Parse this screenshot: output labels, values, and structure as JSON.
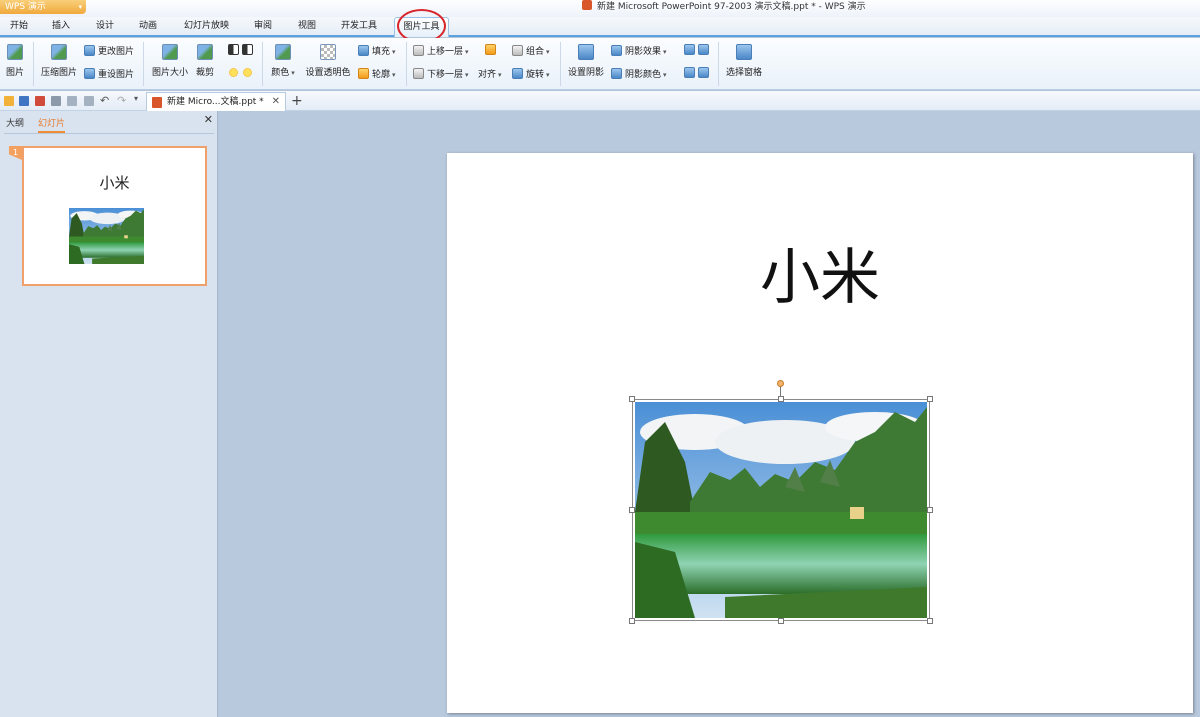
{
  "app_button": "WPS 演示",
  "window_title": "新建 Microsoft PowerPoint 97-2003 演示文稿.ppt * - WPS 演示",
  "tabs": [
    "开始",
    "插入",
    "设计",
    "动画",
    "幻灯片放映",
    "审阅",
    "视图",
    "开发工具",
    "图片工具"
  ],
  "active_tab": "图片工具",
  "ribbon": {
    "picture": "图片",
    "compress": "压缩图片",
    "change_picture": "更改图片",
    "reset_picture": "重设图片",
    "picture_size": "图片大小",
    "crop": "裁剪",
    "color": "颜色",
    "set_transparent": "设置透明色",
    "fill": "填充",
    "outline": "轮廓",
    "bring_forward": "上移一层",
    "send_backward": "下移一层",
    "align": "对齐",
    "group": "组合",
    "rotate": "旋转",
    "set_shadow": "设置阴影",
    "shadow_effect": "阴影效果",
    "shadow_color": "阴影颜色",
    "selection_pane": "选择窗格"
  },
  "doc_tab": "新建 Micro...文稿.ppt *",
  "left_pane": {
    "tabs": [
      "大纲",
      "幻灯片"
    ],
    "active": "幻灯片",
    "slide_number": "1",
    "thumb_title": "小米"
  },
  "slide": {
    "title": "小米"
  },
  "colors": {
    "accent": "#f08c34",
    "tab_underline": "#5aa3e0",
    "annotation_circle": "#d8262c"
  }
}
